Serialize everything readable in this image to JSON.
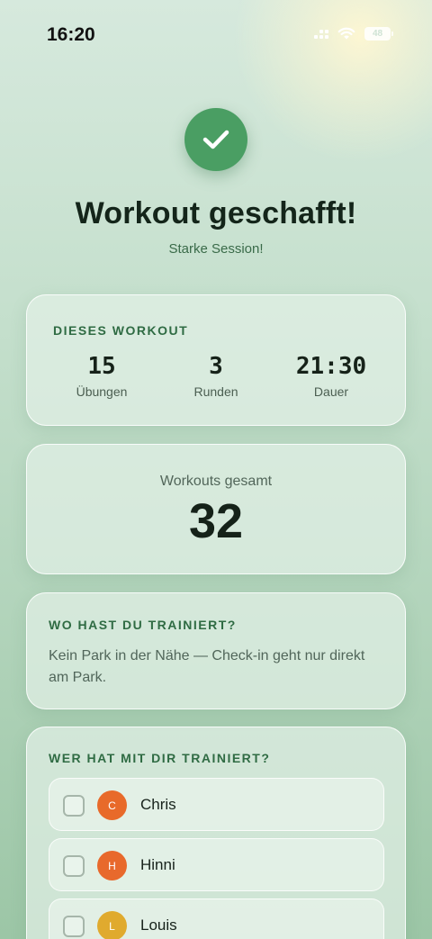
{
  "status_bar": {
    "time": "16:20",
    "battery": "48"
  },
  "header": {
    "title": "Workout geschafft!",
    "subtitle": "Starke Session!"
  },
  "stats": {
    "heading": "DIESES WORKOUT",
    "items": [
      {
        "value": "15",
        "label": "Übungen"
      },
      {
        "value": "3",
        "label": "Runden"
      },
      {
        "value": "21:30",
        "label": "Dauer"
      }
    ]
  },
  "total": {
    "label": "Workouts gesamt",
    "value": "32"
  },
  "location": {
    "heading": "WO HAST DU TRAINIERT?",
    "text": "Kein Park in der Nähe — Check-in geht nur direkt am Park."
  },
  "partners": {
    "heading": "WER HAT MIT DIR TRAINIERT?",
    "people": [
      {
        "initial": "C",
        "name": "Chris",
        "color": "#e86a2a",
        "checked": false
      },
      {
        "initial": "H",
        "name": "Hinni",
        "color": "#e8692c",
        "checked": false
      },
      {
        "initial": "L",
        "name": "Louis",
        "color": "#e0aa2e",
        "checked": false
      }
    ]
  },
  "colors": {
    "accent": "#4a9e63",
    "heading": "#2f6b43"
  }
}
